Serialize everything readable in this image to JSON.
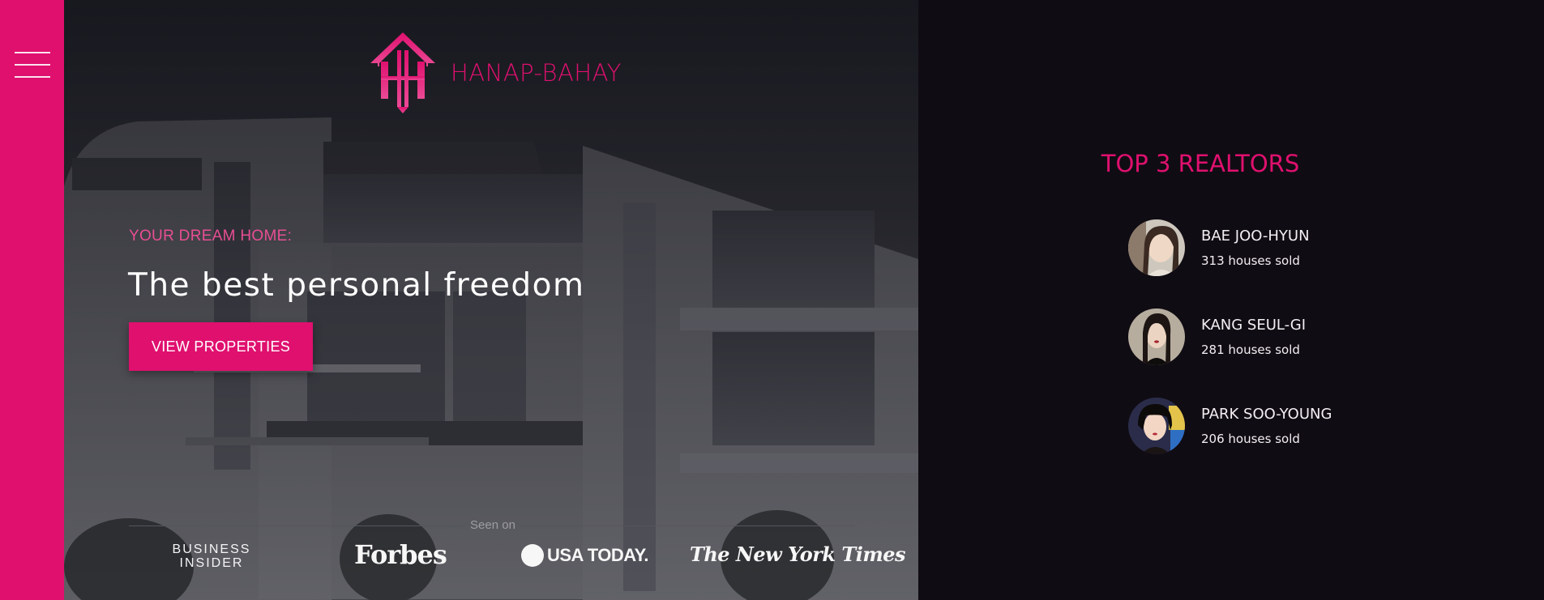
{
  "nav": {
    "menu_icon": "hamburger-menu-icon"
  },
  "brand": {
    "name": "HANAP-BAHAY",
    "logo_icon": "house-logo-icon"
  },
  "hero": {
    "eyebrow": "YOUR DREAM HOME:",
    "headline": "The best personal freedom",
    "cta_label": "VIEW PROPERTIES",
    "background": "modern-building-photo"
  },
  "press": {
    "label": "Seen on",
    "logos": [
      {
        "name": "business-insider-logo",
        "line1": "BUSINESS",
        "line2": "INSIDER"
      },
      {
        "name": "forbes-logo",
        "text": "Forbes"
      },
      {
        "name": "usa-today-logo",
        "text": "USA TODAY."
      },
      {
        "name": "nyt-logo",
        "text": "The New York Times"
      }
    ]
  },
  "realtors": {
    "title": "TOP 3 REALTORS",
    "items": [
      {
        "name": "BAE JOO-HYUN",
        "sold": "313 houses sold"
      },
      {
        "name": "KANG SEUL-GI",
        "sold": "281 houses sold"
      },
      {
        "name": "PARK SOO-YOUNG",
        "sold": "206 houses sold"
      }
    ]
  },
  "colors": {
    "accent": "#e0106f",
    "panel_bg": "#100c13",
    "text_light": "#f2eef2"
  }
}
